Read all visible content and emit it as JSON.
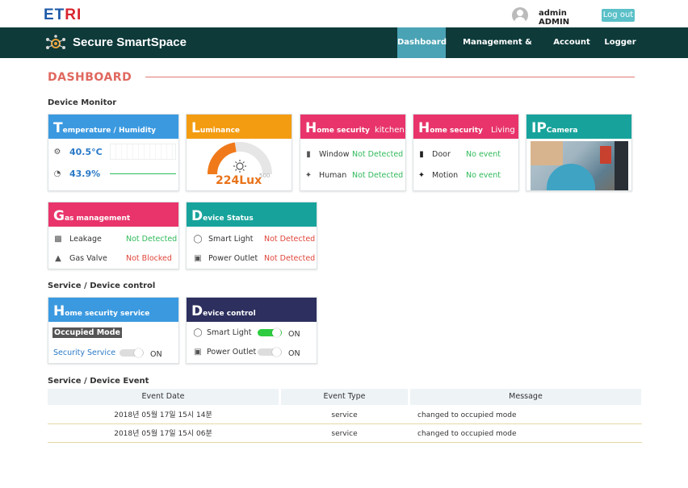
{
  "topbar": {
    "logo": "ETRI",
    "user_name": "admin",
    "user_role": "ADMIN",
    "logout_label": "Log out"
  },
  "nav": {
    "brand": "Secure SmartSpace",
    "items": [
      "Dashboard",
      "Management & Security",
      "Account",
      "Logger"
    ],
    "active_index": 0
  },
  "page_title": "DASHBOARD",
  "device_monitor": {
    "label": "Device Monitor",
    "temp_humidity": {
      "title_big": "T",
      "title_rest": "emperature / Humidity",
      "temperature": "40.5°C",
      "humidity": "43.9%",
      "color": "#3b99e0"
    },
    "luminance": {
      "title_big": "L",
      "title_rest": "uminance",
      "value": "224Lux",
      "gauge_max": "500",
      "gauge_fraction": 0.45,
      "color": "#f39c12"
    },
    "home_security_kitchen": {
      "title_big": "H",
      "title_rest": "ome security",
      "location": "kitchen",
      "rows": [
        {
          "label": "Window",
          "status": "Not Detected"
        },
        {
          "label": "Human",
          "status": "Not Detected"
        }
      ],
      "color": "#e8346a"
    },
    "home_security_living": {
      "title_big": "H",
      "title_rest": "ome security",
      "location": "Living",
      "rows": [
        {
          "label": "Door",
          "status": "No event"
        },
        {
          "label": "Motion",
          "status": "No event"
        }
      ],
      "color": "#e8346a"
    },
    "ip_camera": {
      "title_big": "IP",
      "title_rest": "Camera",
      "color": "#17a39b"
    },
    "gas": {
      "title_big": "G",
      "title_rest": "as management",
      "rows": [
        {
          "label": "Leakage",
          "status": "Not Detected"
        },
        {
          "label": "Gas Valve",
          "status": "Not Blocked"
        }
      ],
      "color": "#e8346a"
    },
    "device_status": {
      "title_big": "D",
      "title_rest": "evice Status",
      "rows": [
        {
          "label": "Smart Light",
          "status": "Not Detected"
        },
        {
          "label": "Power Outlet",
          "status": "Not Detected"
        }
      ],
      "color": "#17a39b"
    }
  },
  "service_control": {
    "label": "Service / Device control",
    "home_security_service": {
      "title_big": "H",
      "title_rest": "ome security service",
      "mode": "Occupied Mode",
      "service_label": "Security Service",
      "service_state": "ON",
      "service_on": false,
      "color": "#3b99e0"
    },
    "device_control": {
      "title_big": "D",
      "title_rest": "evice control",
      "rows": [
        {
          "label": "Smart Light",
          "state": "ON",
          "on": true
        },
        {
          "label": "Power Outlet",
          "state": "ON",
          "on": false
        }
      ],
      "color": "#2d2f5e"
    }
  },
  "event_log": {
    "label": "Service / Device Event",
    "columns": [
      "Event Date",
      "Event Type",
      "Message"
    ],
    "rows": [
      [
        "2018년 05월 17일 15시 14분",
        "service",
        "changed to occupied mode"
      ],
      [
        "2018년 05월 17일 15시 06분",
        "service",
        "changed to occupied mode"
      ]
    ]
  }
}
